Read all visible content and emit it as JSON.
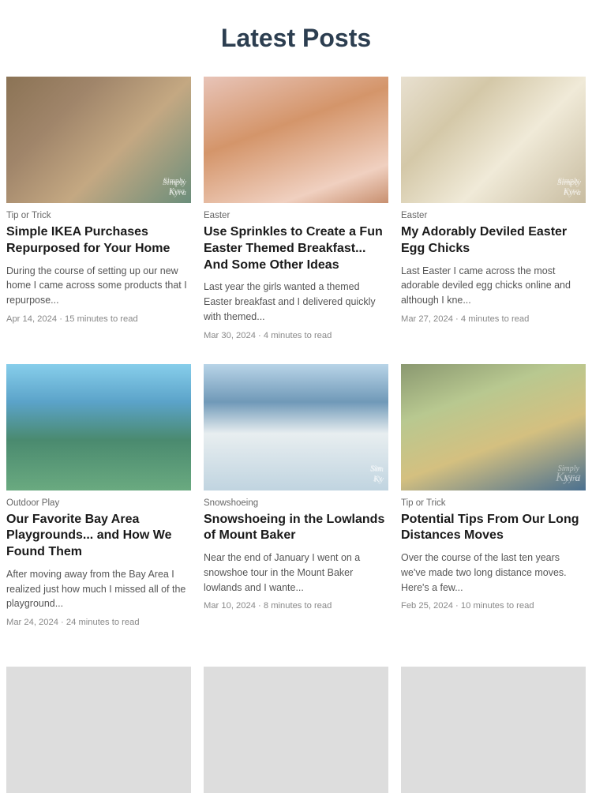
{
  "header": {
    "title": "Latest Posts"
  },
  "posts": [
    {
      "id": "post-ikea",
      "category": "Tip or Trick",
      "title": "Simple IKEA Purchases Repurposed for Your Home",
      "excerpt": "During the course of setting up our new home I came across some products that I repurpose...",
      "date": "Apr 14, 2024",
      "read_time": "15 minutes to read",
      "image_type": "ikea",
      "watermark": "Simply\nKyra"
    },
    {
      "id": "post-sprinkles",
      "category": "Easter",
      "title": "Use Sprinkles to Create a Fun Easter Themed Breakfast... And Some Other Ideas",
      "excerpt": "Last year the girls wanted a themed Easter breakfast and I delivered quickly with themed...",
      "date": "Mar 30, 2024",
      "read_time": "4 minutes to read",
      "image_type": "sprinkles",
      "watermark": ""
    },
    {
      "id": "post-easter-egg",
      "category": "Easter",
      "title": "My Adorably Deviled Easter Egg Chicks",
      "excerpt": "Last Easter I came across the most adorable deviled egg chicks online and although I kne...",
      "date": "Mar 27, 2024",
      "read_time": "4 minutes to read",
      "image_type": "easter-egg",
      "watermark": "Simply\nKyra"
    },
    {
      "id": "post-playground",
      "category": "Outdoor Play",
      "title": "Our Favorite Bay Area Playgrounds... and How We Found Them",
      "excerpt": "After moving away from the Bay Area I realized just how much I missed all of the playground...",
      "date": "Mar 24, 2024",
      "read_time": "24 minutes to read",
      "image_type": "playground",
      "watermark": ""
    },
    {
      "id": "post-snowshoe",
      "category": "Snowshoeing",
      "title": "Snowshoeing in the Lowlands of Mount Baker",
      "excerpt": "Near the end of January I went on a snowshoe tour in the Mount Baker lowlands and I wante...",
      "date": "Mar 10, 2024",
      "read_time": "8 minutes to read",
      "image_type": "snowshoe",
      "watermark": "Sim\nKy"
    },
    {
      "id": "post-longdistance",
      "category": "Tip or Trick",
      "title": "Potential Tips From Our Long Distances Moves",
      "excerpt": "Over the course of the last ten years we've made two long distance moves. Here's a few...",
      "date": "Feb 25, 2024",
      "read_time": "10 minutes to read",
      "image_type": "longdistance",
      "watermark": "Simply\nKyra"
    }
  ],
  "bottom_images": [
    {
      "id": "bottom-food",
      "image_type": "food1"
    },
    {
      "id": "bottom-craft",
      "image_type": "craft"
    },
    {
      "id": "bottom-outdoor",
      "image_type": "outdoor2"
    }
  ]
}
